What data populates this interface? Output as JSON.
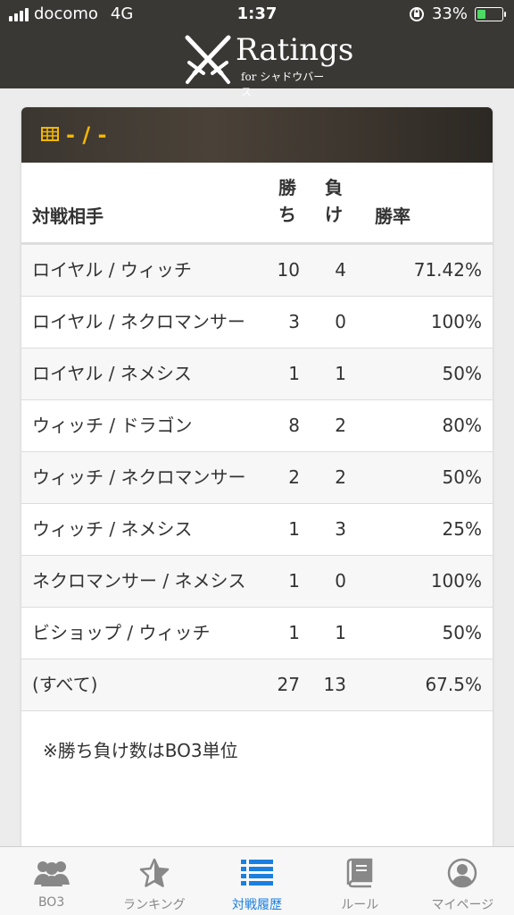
{
  "status_bar": {
    "carrier": "docomo",
    "network": "4G",
    "time": "1:37",
    "battery": "33%",
    "battery_level": 0.33
  },
  "header": {
    "title": "Ratings",
    "subtitle": "for シャドウバース"
  },
  "card": {
    "title": "- / -",
    "columns": {
      "opponent": "対戦相手",
      "wins": "勝ち",
      "losses": "負け",
      "rate": "勝率"
    },
    "rows": [
      {
        "opponent": "ロイヤル / ウィッチ",
        "wins": "10",
        "losses": "4",
        "rate": "71.42%"
      },
      {
        "opponent": "ロイヤル / ネクロマンサー",
        "wins": "3",
        "losses": "0",
        "rate": "100%"
      },
      {
        "opponent": "ロイヤル / ネメシス",
        "wins": "1",
        "losses": "1",
        "rate": "50%"
      },
      {
        "opponent": "ウィッチ / ドラゴン",
        "wins": "8",
        "losses": "2",
        "rate": "80%"
      },
      {
        "opponent": "ウィッチ / ネクロマンサー",
        "wins": "2",
        "losses": "2",
        "rate": "50%"
      },
      {
        "opponent": "ウィッチ / ネメシス",
        "wins": "1",
        "losses": "3",
        "rate": "25%"
      },
      {
        "opponent": "ネクロマンサー / ネメシス",
        "wins": "1",
        "losses": "0",
        "rate": "100%"
      },
      {
        "opponent": "ビショップ / ウィッチ",
        "wins": "1",
        "losses": "1",
        "rate": "50%"
      }
    ],
    "total": {
      "opponent": "(すべて)",
      "wins": "27",
      "losses": "13",
      "rate": "67.5%"
    },
    "note": "※勝ち負け数はBO3単位"
  },
  "tabs": [
    {
      "label": "BO3",
      "icon": "users-icon"
    },
    {
      "label": "ランキング",
      "icon": "star-icon"
    },
    {
      "label": "対戦履歴",
      "icon": "list-icon",
      "active": true
    },
    {
      "label": "ルール",
      "icon": "book-icon"
    },
    {
      "label": "マイページ",
      "icon": "user-icon"
    }
  ],
  "colors": {
    "header_bg": "#3a3835",
    "accent_gold": "#f5b700",
    "tab_active": "#1a7fe0",
    "tab_inactive": "#888888",
    "battery_fill": "#4cd964"
  }
}
